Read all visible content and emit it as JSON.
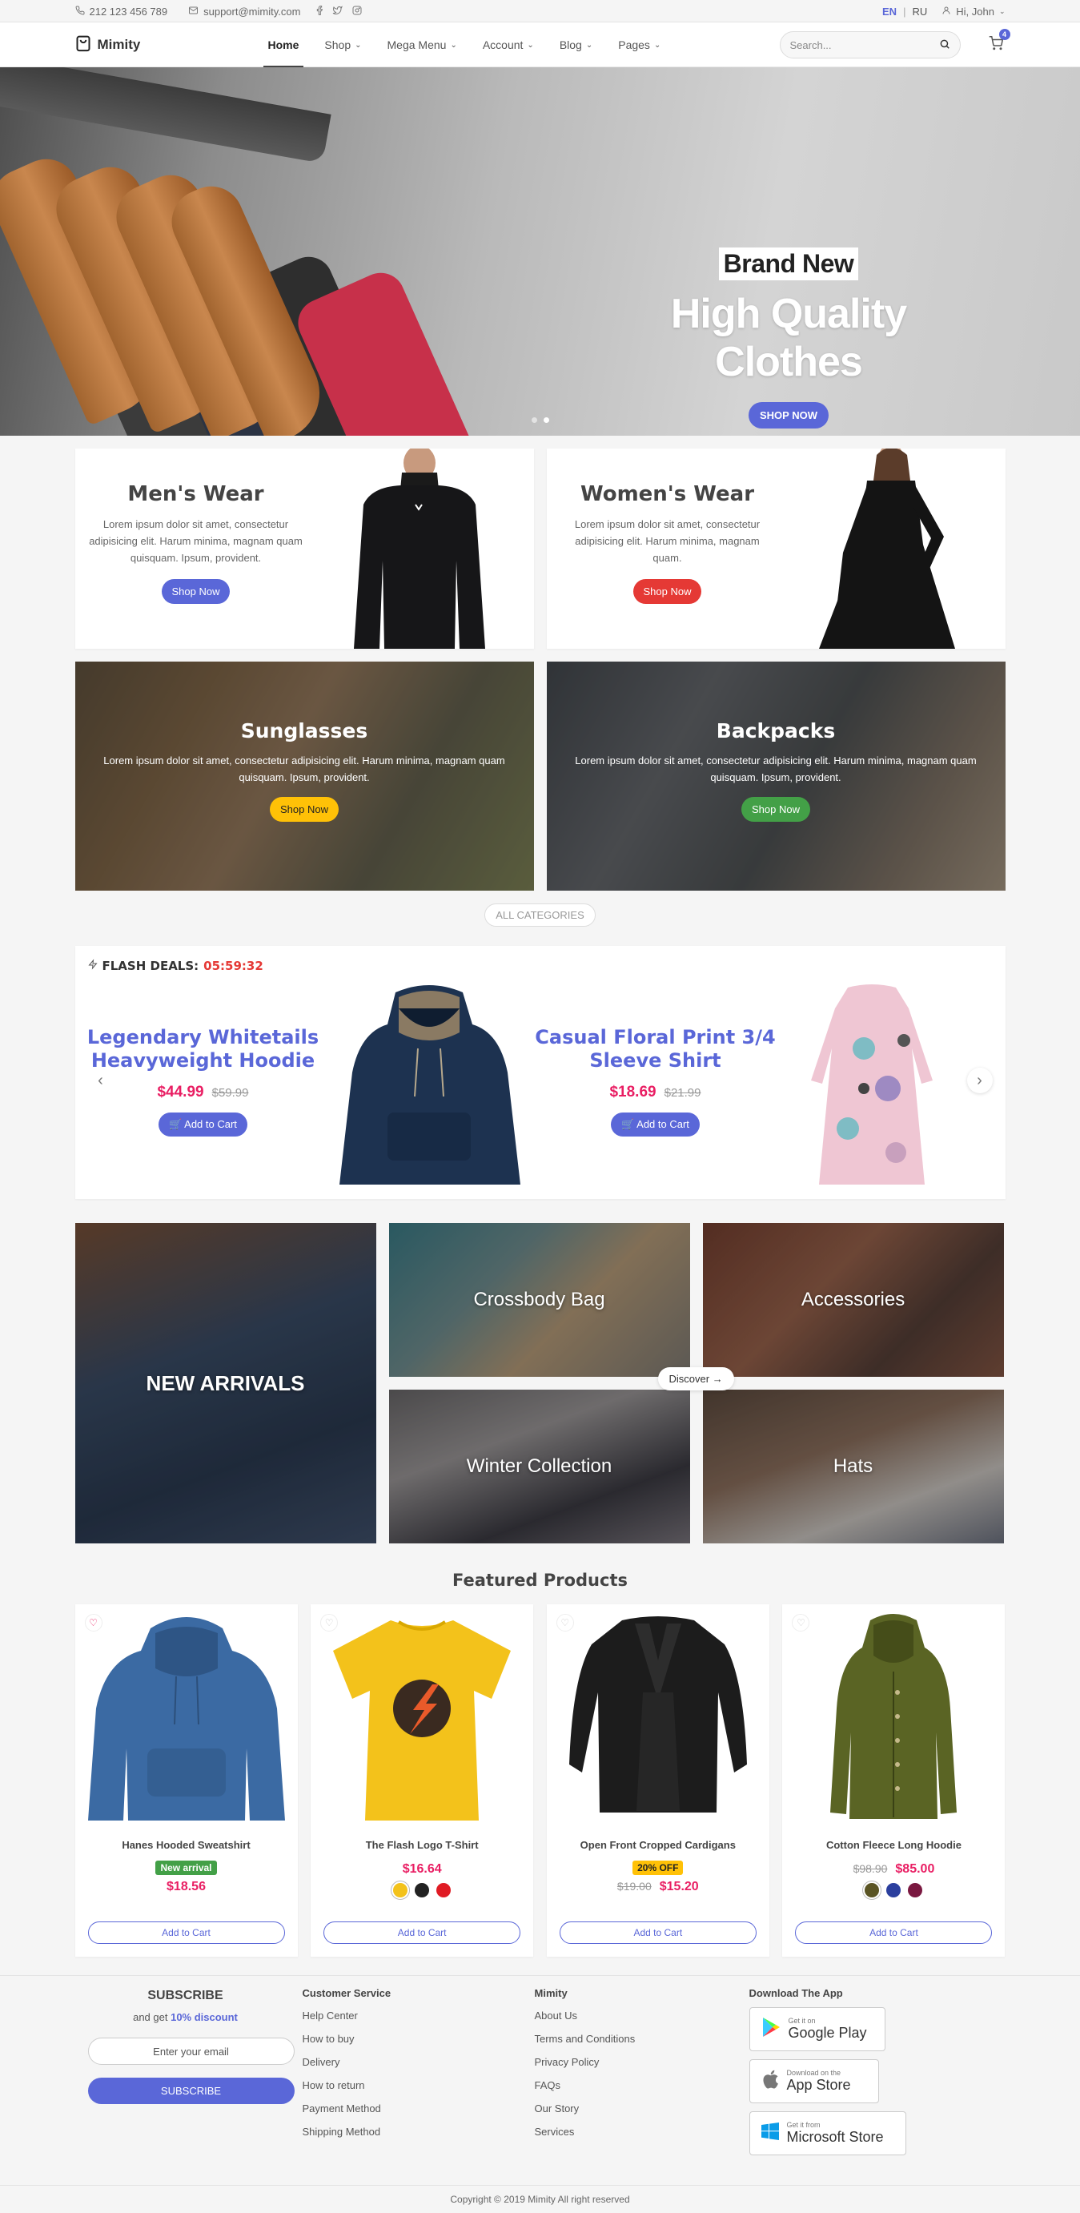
{
  "topbar": {
    "phone": "212 123 456 789",
    "email": "support@mimity.com",
    "lang_en": "EN",
    "lang_sep": "|",
    "lang_ru": "RU",
    "user": "Hi, John"
  },
  "navbar": {
    "brand": "Mimity",
    "menu": [
      {
        "label": "Home",
        "dropdown": false
      },
      {
        "label": "Shop",
        "dropdown": true
      },
      {
        "label": "Mega Menu",
        "dropdown": true
      },
      {
        "label": "Account",
        "dropdown": true
      },
      {
        "label": "Blog",
        "dropdown": true
      },
      {
        "label": "Pages",
        "dropdown": true
      }
    ],
    "search_placeholder": "Search...",
    "cart_count": "4"
  },
  "hero": {
    "tag": "Brand New",
    "title": "High Quality Clothes",
    "button": "SHOP NOW"
  },
  "categories": {
    "mens": {
      "title": "Men's Wear",
      "desc": "Lorem ipsum dolor sit amet, consectetur adipisicing elit. Harum minima, magnam quam quisquam. Ipsum, provident.",
      "button": "Shop Now"
    },
    "womens": {
      "title": "Women's Wear",
      "desc": "Lorem ipsum dolor sit amet, consectetur adipisicing elit. Harum minima, magnam quam.",
      "button": "Shop Now"
    },
    "sunglasses": {
      "title": "Sunglasses",
      "desc": "Lorem ipsum dolor sit amet, consectetur adipisicing elit. Harum minima, magnam quam quisquam. Ipsum, provident.",
      "button": "Shop Now"
    },
    "backpacks": {
      "title": "Backpacks",
      "desc": "Lorem ipsum dolor sit amet, consectetur adipisicing elit. Harum minima, magnam quam quisquam. Ipsum, provident.",
      "button": "Shop Now"
    },
    "all": "ALL CATEGORIES"
  },
  "flash": {
    "label": "FLASH DEALS:",
    "timer": "05:59:32",
    "deals": [
      {
        "title": "Legendary Whitetails Heavyweight Hoodie",
        "price": "$44.99",
        "old": "$59.99",
        "button": "Add to Cart"
      },
      {
        "title": "Casual Floral Print 3/4 Sleeve Shirt",
        "price": "$18.69",
        "old": "$21.99",
        "button": "Add to Cart"
      }
    ]
  },
  "collections": {
    "new_arrivals": "NEW ARRIVALS",
    "crossbody": "Crossbody Bag",
    "accessories": "Accessories",
    "winter": "Winter Collection",
    "hats": "Hats",
    "discover": "Discover"
  },
  "featured": {
    "title": "Featured Products",
    "products": [
      {
        "name": "Hanes Hooded Sweatshirt",
        "badge": "New arrival",
        "price": "$18.56",
        "old": "",
        "button": "Add to Cart"
      },
      {
        "name": "The Flash Logo T-Shirt",
        "badge": "",
        "price": "$16.64",
        "old": "",
        "button": "Add to Cart"
      },
      {
        "name": "Open Front Cropped Cardigans",
        "badge": "20% OFF",
        "price": "$15.20",
        "old": "$19.00",
        "button": "Add to Cart"
      },
      {
        "name": "Cotton Fleece Long Hoodie",
        "badge": "",
        "price": "$85.00",
        "old": "$98.90",
        "button": "Add to Cart"
      }
    ]
  },
  "footer": {
    "subscribe_title": "SUBSCRIBE",
    "subscribe_text": "and get",
    "subscribe_discount": "10% discount",
    "email_placeholder": "Enter your email",
    "subscribe_button": "SUBSCRIBE",
    "customer_service": {
      "title": "Customer Service",
      "links": [
        "Help Center",
        "How to buy",
        "Delivery",
        "How to return",
        "Payment Method",
        "Shipping Method"
      ]
    },
    "mimity": {
      "title": "Mimity",
      "links": [
        "About Us",
        "Terms and Conditions",
        "Privacy Policy",
        "FAQs",
        "Our Story",
        "Services"
      ]
    },
    "app": {
      "title": "Download The App",
      "stores": [
        {
          "small": "Get it on",
          "big": "Google Play"
        },
        {
          "small": "Download on the",
          "big": "App Store"
        },
        {
          "small": "Get it from",
          "big": "Microsoft Store"
        }
      ]
    },
    "copyright": "Copyright © 2019 Mimity All right reserved"
  }
}
